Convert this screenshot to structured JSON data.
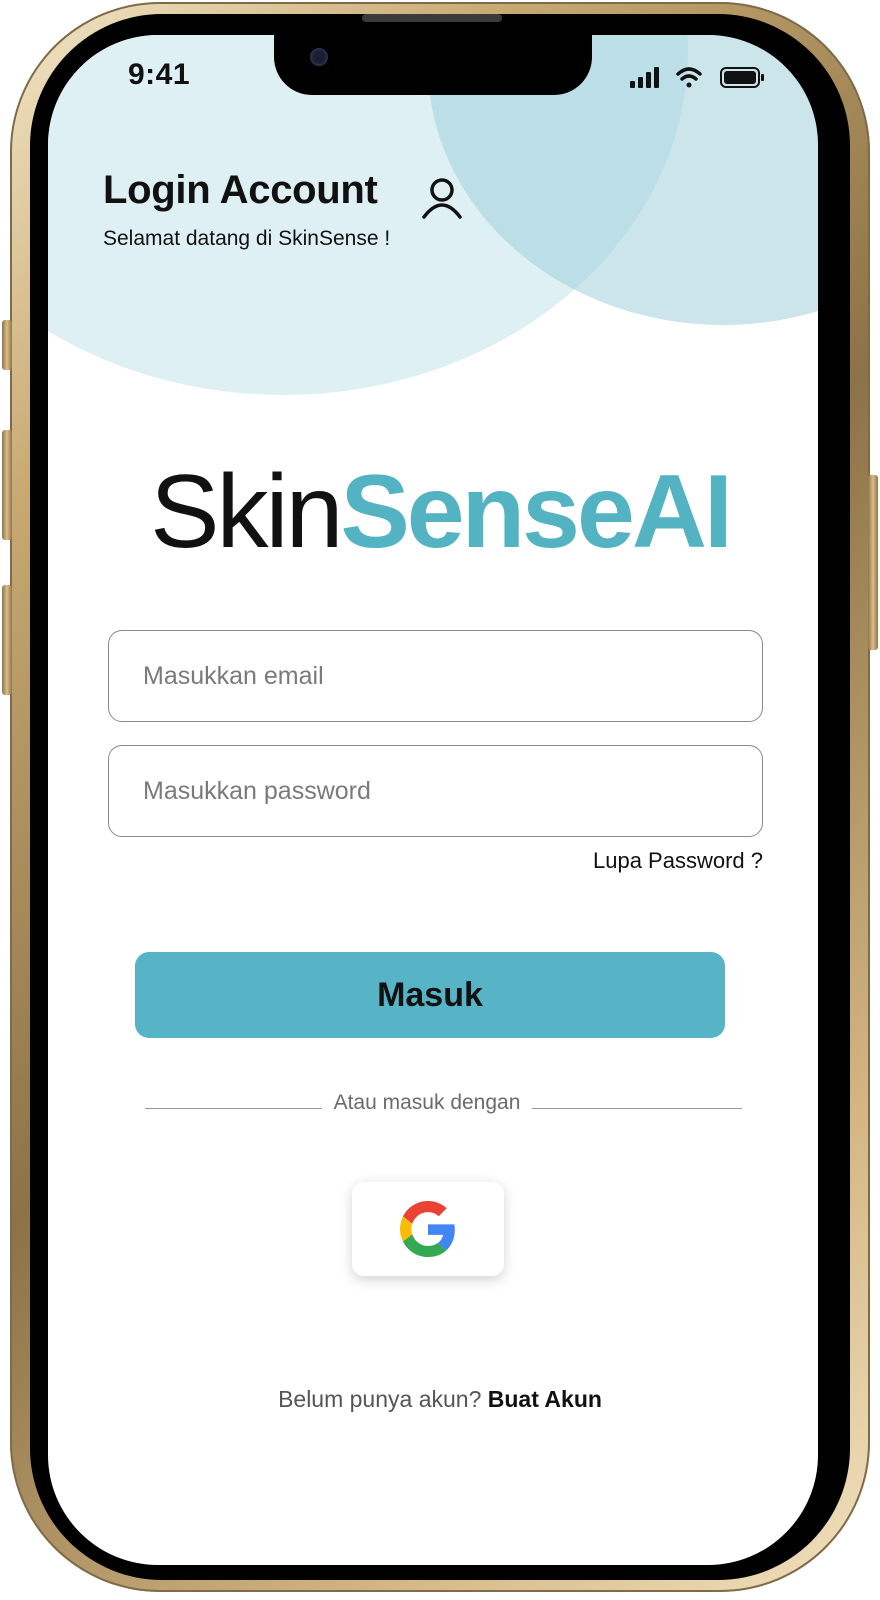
{
  "status_bar": {
    "time": "9:41",
    "icons": [
      "signal-icon",
      "wifi-icon",
      "battery-icon"
    ]
  },
  "header": {
    "title": "Login Account",
    "subtitle": "Selamat datang di SkinSense !",
    "icon": "user-icon"
  },
  "logo": {
    "part1": "Skin",
    "part2": "SenseAI"
  },
  "form": {
    "email_placeholder": "Masukkan email",
    "email_value": "",
    "password_placeholder": "Masukkan password",
    "password_value": "",
    "forgot_label": "Lupa Password ?",
    "submit_label": "Masuk"
  },
  "alt_login": {
    "divider_text": "Atau masuk dengan",
    "provider_icon": "google-icon"
  },
  "footer": {
    "prompt": "Belum punya akun?",
    "link_label": "Buat Akun"
  },
  "colors": {
    "accent": "#53b3c3",
    "button": "#56b4c6",
    "blob_light": "#def0f3",
    "blob_dark": "#a0d0db",
    "text": "#111111"
  }
}
